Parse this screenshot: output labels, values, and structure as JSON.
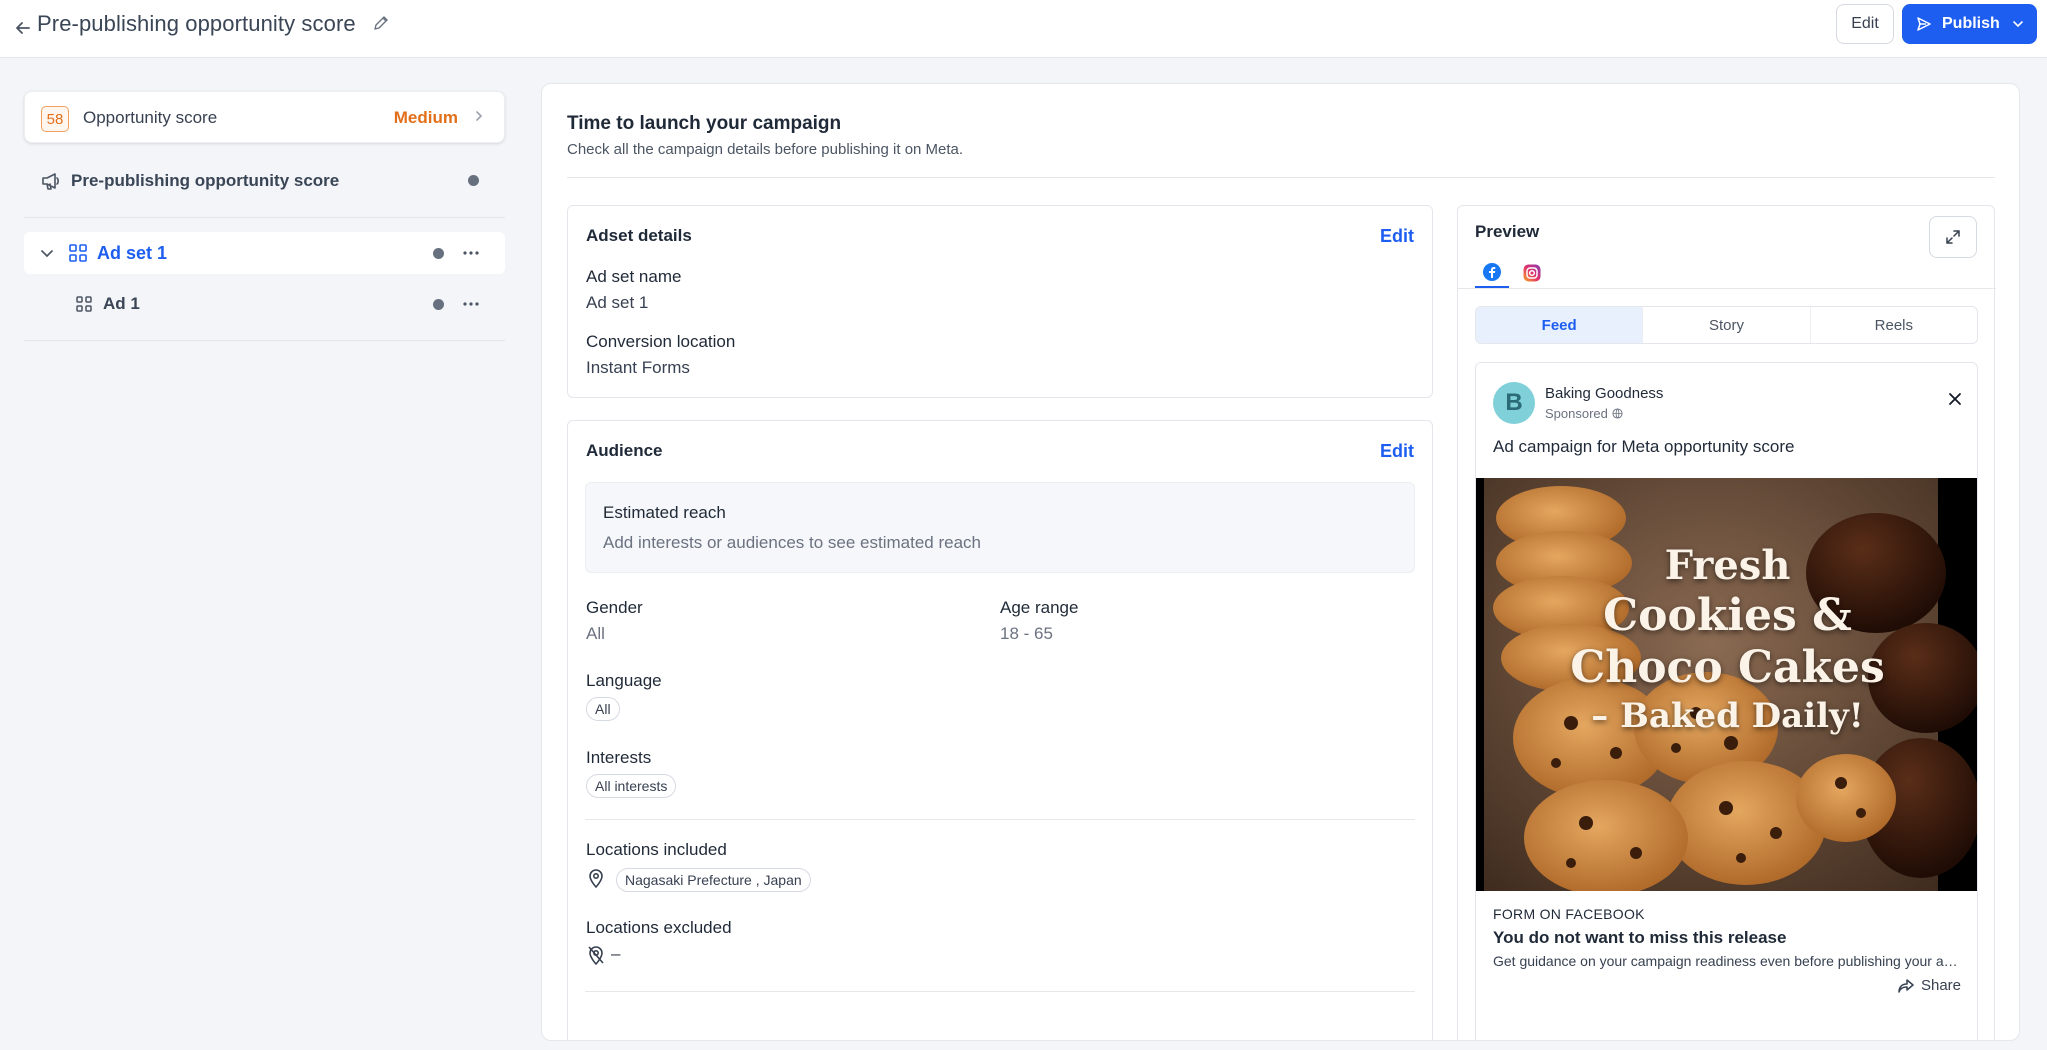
{
  "header": {
    "title": "Pre-publishing opportunity score",
    "edit_label": "Edit",
    "publish_label": "Publish"
  },
  "sidebar": {
    "opportunity": {
      "score": "58",
      "label": "Opportunity score",
      "level": "Medium"
    },
    "pre_publishing_label": "Pre-publishing opportunity score",
    "adset_label": "Ad set 1",
    "ad_label": "Ad 1"
  },
  "main": {
    "title": "Time to launch your campaign",
    "subtitle": "Check all the campaign details before publishing it on Meta.",
    "adset_details": {
      "title": "Adset details",
      "edit_label": "Edit",
      "name_label": "Ad set name",
      "name_value": "Ad set 1",
      "conversion_label": "Conversion location",
      "conversion_value": "Instant Forms"
    },
    "audience": {
      "title": "Audience",
      "edit_label": "Edit",
      "reach_title": "Estimated reach",
      "reach_sub": "Add interests or audiences to see estimated reach",
      "gender_label": "Gender",
      "gender_value": "All",
      "age_label": "Age range",
      "age_value": "18 - 65",
      "language_label": "Language",
      "language_value": "All",
      "interests_label": "Interests",
      "interests_value": "All interests",
      "loc_incl_label": "Locations included",
      "loc_incl_value": "Nagasaki Prefecture , Japan",
      "loc_excl_label": "Locations excluded",
      "loc_excl_value": "–"
    },
    "preview": {
      "title": "Preview",
      "tabs": [
        "Feed",
        "Story",
        "Reels"
      ],
      "active_tab": "Feed",
      "networks": [
        "facebook-icon",
        "instagram-icon"
      ],
      "post": {
        "avatar_letter": "B",
        "page_name": "Baking Goodness",
        "sponsored": "Sponsored",
        "text": "Ad campaign for Meta opportunity score",
        "image_headline": [
          "Fresh",
          "Cookies &",
          "Choco Cakes",
          "– Baked Daily!"
        ],
        "cta_type": "FORM ON FACEBOOK",
        "cta_headline": "You do not want to miss this release",
        "cta_desc": "Get guidance on your campaign readiness even before publishing your ads on Meta.",
        "share_label": "Share"
      }
    }
  },
  "colors": {
    "accent": "#1d5ef0",
    "score_orange": "#e2701b",
    "background": "#f3f5f8"
  }
}
